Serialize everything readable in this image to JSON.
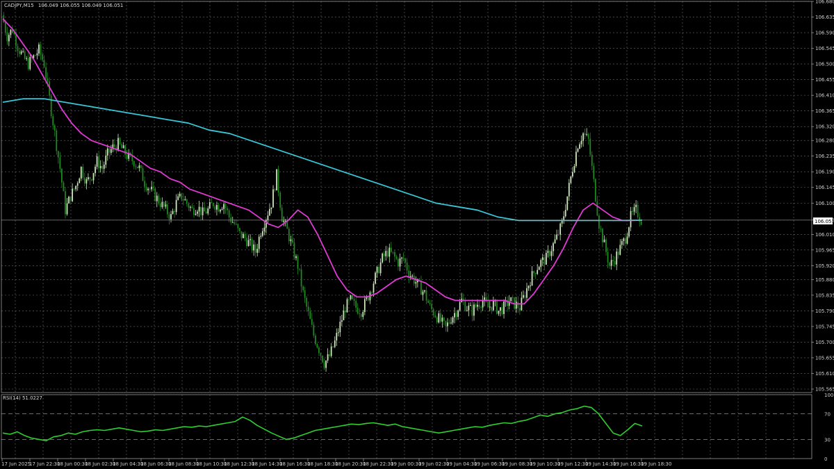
{
  "header": {
    "symbol": "CADJPY,M15",
    "ohlc": "106.049 106.055 106.049 106.051"
  },
  "rsi_header": "RSI(14) 51.0227",
  "price_badge": "106.051",
  "colors": {
    "background": "#000000",
    "grid": "#6e6e6e",
    "bull_candle": "#cfe8bd",
    "bear_candle": "#1f8a1f",
    "fast_ma": "#e23ad6",
    "slow_ma": "#39c6d8",
    "rsi_line": "#2ecf2e"
  },
  "chart_data": [
    {
      "type": "candlestick",
      "title": "CADJPY,M15",
      "ylim": [
        105.555,
        106.68
      ],
      "y_ticks": [
        "106.680",
        "106.635",
        "106.590",
        "106.545",
        "106.500",
        "106.455",
        "106.410",
        "106.365",
        "106.320",
        "106.280",
        "106.235",
        "106.190",
        "106.145",
        "106.100",
        "106.051",
        "106.010",
        "105.965",
        "105.920",
        "105.880",
        "105.835",
        "105.790",
        "105.745",
        "105.700",
        "105.655",
        "105.610",
        "105.565"
      ],
      "x_ticks": [
        "17 Jun 2025",
        "17 Jun 22:30",
        "18 Jun 00:30",
        "18 Jun 02:30",
        "18 Jun 04:30",
        "18 Jun 06:30",
        "18 Jun 08:30",
        "18 Jun 10:30",
        "18 Jun 12:30",
        "18 Jun 14:30",
        "18 Jun 16:30",
        "18 Jun 18:30",
        "18 Jun 20:30",
        "18 Jun 22:30",
        "19 Jun 00:30",
        "19 Jun 02:30",
        "19 Jun 04:30",
        "19 Jun 06:30",
        "19 Jun 08:30",
        "19 Jun 10:30",
        "19 Jun 12:30",
        "19 Jun 14:30",
        "19 Jun 16:30",
        "19 Jun 18:30"
      ],
      "price_path": [
        106.64,
        106.58,
        106.6,
        106.55,
        106.52,
        106.5,
        106.52,
        106.54,
        106.5,
        106.4,
        106.3,
        106.2,
        106.08,
        106.12,
        106.15,
        106.2,
        106.16,
        106.18,
        106.22,
        106.2,
        106.24,
        106.26,
        106.27,
        106.25,
        106.23,
        106.22,
        106.2,
        106.16,
        106.14,
        106.12,
        106.1,
        106.08,
        106.06,
        106.1,
        106.12,
        106.1,
        106.08,
        106.09,
        106.07,
        106.08,
        106.1,
        106.09,
        106.1,
        106.06,
        106.04,
        106.01,
        106.0,
        105.98,
        105.96,
        106.02,
        106.06,
        106.1,
        106.18,
        106.06,
        106.02,
        105.97,
        105.92,
        105.84,
        105.78,
        105.72,
        105.68,
        105.64,
        105.66,
        105.7,
        105.75,
        105.8,
        105.82,
        105.8,
        105.79,
        105.82,
        105.86,
        105.9,
        105.94,
        105.96,
        105.95,
        105.93,
        105.94,
        105.9,
        105.88,
        105.86,
        105.84,
        105.8,
        105.78,
        105.76,
        105.74,
        105.77,
        105.79,
        105.82,
        105.8,
        105.79,
        105.81,
        105.82,
        105.8,
        105.81,
        105.79,
        105.8,
        105.82,
        105.81,
        105.8,
        105.84,
        105.88,
        105.91,
        105.93,
        105.94,
        105.97,
        106.0,
        106.04,
        106.12,
        106.2,
        106.27,
        106.3,
        106.28,
        106.16,
        106.04,
        105.98,
        105.92,
        105.94,
        105.97,
        106.0,
        106.06,
        106.08,
        106.051
      ],
      "series": [
        {
          "name": "MA fast",
          "values": [
            106.63,
            106.6,
            106.56,
            106.52,
            106.47,
            106.42,
            106.37,
            106.33,
            106.3,
            106.28,
            106.27,
            106.26,
            106.25,
            106.24,
            106.22,
            106.2,
            106.19,
            106.17,
            106.16,
            106.14,
            106.13,
            106.12,
            106.11,
            106.1,
            106.09,
            106.08,
            106.06,
            106.04,
            106.03,
            106.05,
            106.08,
            106.06,
            106.01,
            105.95,
            105.89,
            105.85,
            105.83,
            105.83,
            105.84,
            105.86,
            105.88,
            105.89,
            105.88,
            105.87,
            105.85,
            105.83,
            105.82,
            105.82,
            105.82,
            105.82,
            105.82,
            105.82,
            105.81,
            105.81,
            105.84,
            105.88,
            105.92,
            105.97,
            106.03,
            106.08,
            106.1,
            106.08,
            106.06,
            106.05,
            106.05,
            106.051
          ]
        },
        {
          "name": "MA slow",
          "values": [
            106.39,
            106.4,
            106.4,
            106.39,
            106.38,
            106.37,
            106.36,
            106.35,
            106.34,
            106.33,
            106.31,
            106.3,
            106.28,
            106.26,
            106.24,
            106.22,
            106.2,
            106.18,
            106.16,
            106.14,
            106.12,
            106.1,
            106.09,
            106.08,
            106.06,
            106.05,
            106.05,
            106.05,
            106.05,
            106.05,
            106.05,
            106.051
          ]
        }
      ]
    },
    {
      "type": "line",
      "title": "RSI(14) 51.0227",
      "ylim": [
        0,
        100
      ],
      "y_ticks": [
        "100",
        "70",
        "30",
        "0"
      ],
      "levels": [
        70,
        30
      ],
      "series": [
        {
          "name": "RSI(14)",
          "values": [
            40,
            38,
            42,
            36,
            32,
            30,
            28,
            34,
            36,
            40,
            38,
            42,
            44,
            45,
            44,
            46,
            48,
            46,
            44,
            42,
            43,
            45,
            44,
            46,
            48,
            50,
            49,
            51,
            50,
            52,
            54,
            56,
            58,
            65,
            60,
            52,
            46,
            40,
            35,
            30,
            32,
            36,
            40,
            44,
            46,
            48,
            50,
            52,
            54,
            53,
            55,
            56,
            54,
            52,
            54,
            50,
            48,
            46,
            44,
            42,
            40,
            42,
            44,
            46,
            48,
            50,
            49,
            52,
            54,
            56,
            55,
            58,
            60,
            64,
            68,
            66,
            70,
            72,
            76,
            78,
            82,
            80,
            70,
            55,
            40,
            36,
            45,
            55,
            51
          ]
        }
      ]
    }
  ]
}
